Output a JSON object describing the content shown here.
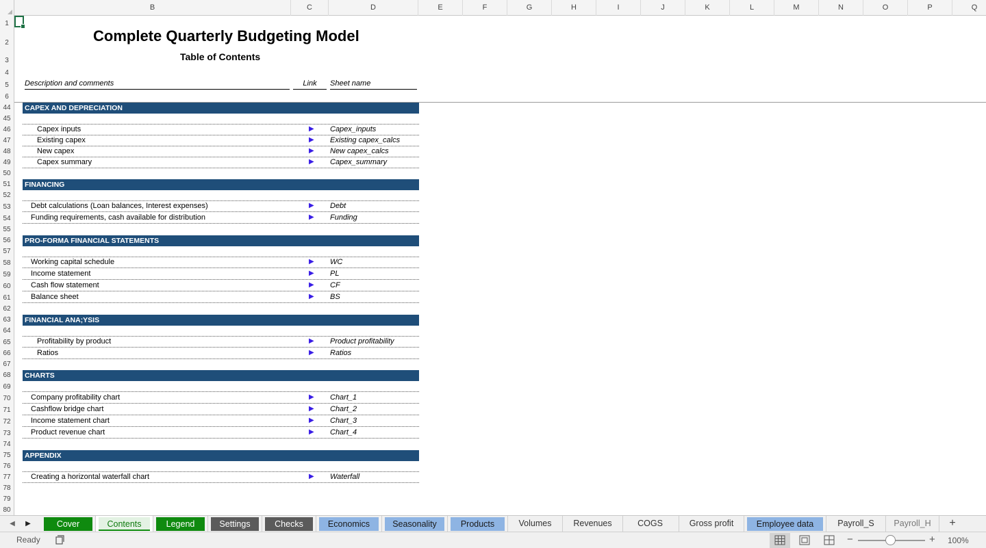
{
  "columns": [
    "B",
    "C",
    "D",
    "E",
    "F",
    "G",
    "H",
    "I",
    "J",
    "K",
    "L",
    "M",
    "N",
    "O",
    "P",
    "Q"
  ],
  "rows": [
    "1",
    "2",
    "3",
    "4",
    "5",
    "6",
    "44",
    "45",
    "46",
    "47",
    "48",
    "49",
    "50",
    "51",
    "52",
    "53",
    "54",
    "55",
    "56",
    "57",
    "58",
    "59",
    "60",
    "61",
    "62",
    "63",
    "64",
    "65",
    "66",
    "67",
    "68",
    "69",
    "70",
    "71",
    "72",
    "73",
    "74",
    "75",
    "76",
    "77",
    "78",
    "79",
    "80"
  ],
  "sheet": {
    "title": "Complete Quarterly Budgeting Model",
    "subtitle": "Table of Contents",
    "headers": {
      "description": "Description and comments",
      "link": "Link",
      "sheet_name": "Sheet name"
    },
    "link_glyph": "▶",
    "sections": [
      {
        "title": "CAPEX AND DEPRECIATION",
        "items": [
          {
            "desc": "Capex inputs",
            "sheet": "Capex_inputs"
          },
          {
            "desc": "Existing capex",
            "sheet": "Existing capex_calcs"
          },
          {
            "desc": "New capex",
            "sheet": "New capex_calcs"
          },
          {
            "desc": "Capex summary",
            "sheet": "Capex_summary"
          }
        ]
      },
      {
        "title": "FINANCING",
        "items": [
          {
            "desc": "Debt calculations (Loan balances, Interest expenses)",
            "sheet": "Debt"
          },
          {
            "desc": "Funding requirements, cash available for distribution",
            "sheet": "Funding"
          }
        ]
      },
      {
        "title": "PRO-FORMA FINANCIAL STATEMENTS",
        "items": [
          {
            "desc": "Working capital schedule",
            "sheet": "WC"
          },
          {
            "desc": "Income statement",
            "sheet": "PL"
          },
          {
            "desc": "Cash flow statement",
            "sheet": "CF"
          },
          {
            "desc": "Balance sheet",
            "sheet": "BS"
          }
        ]
      },
      {
        "title": "FINANCIAL ANA;YSIS",
        "items": [
          {
            "desc": "Profitability by product",
            "sheet": "Product profitability"
          },
          {
            "desc": "Ratios",
            "sheet": "Ratios"
          }
        ]
      },
      {
        "title": "CHARTS",
        "items": [
          {
            "desc": "Company profitability chart",
            "sheet": "Chart_1"
          },
          {
            "desc": "Cashflow bridge chart",
            "sheet": "Chart_2"
          },
          {
            "desc": "Income statement chart",
            "sheet": "Chart_3"
          },
          {
            "desc": "Product revenue chart",
            "sheet": "Chart_4"
          }
        ]
      },
      {
        "title": "APPENDIX",
        "items": [
          {
            "desc": "Creating a horizontal waterfall chart",
            "sheet": "Waterfall"
          }
        ]
      }
    ]
  },
  "tabs": [
    {
      "label": "Cover",
      "color": "#0f8a0f"
    },
    {
      "label": "Contents",
      "color": "#0f8a0f",
      "active": true
    },
    {
      "label": "Legend",
      "color": "#0f8a0f"
    },
    {
      "label": "Settings",
      "color": "#5b5b5b"
    },
    {
      "label": "Checks",
      "color": "#5b5b5b"
    },
    {
      "label": "Economics",
      "color": "#8eb4e3"
    },
    {
      "label": "Seasonality",
      "color": "#8eb4e3"
    },
    {
      "label": "Products",
      "color": "#8eb4e3"
    },
    {
      "label": "Volumes"
    },
    {
      "label": "Revenues"
    },
    {
      "label": "COGS"
    },
    {
      "label": "Gross profit"
    },
    {
      "label": "Employee data",
      "color": "#8eb4e3"
    },
    {
      "label": "Payroll_S"
    },
    {
      "label": "Payroll_H"
    }
  ],
  "tab_nav": {
    "prev": "◀",
    "next": "▶",
    "add": "+"
  },
  "status": {
    "text": "Ready",
    "zoom": "100%",
    "zoom_out": "−",
    "zoom_in": "+"
  }
}
